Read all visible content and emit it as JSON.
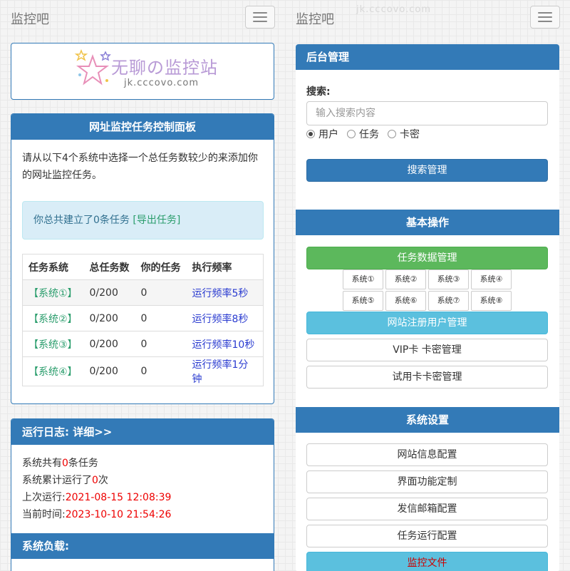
{
  "left": {
    "brand": "监控吧",
    "logo": {
      "title": "无聊の监控站",
      "subtitle": "jk.cccovo.com"
    },
    "task_panel": {
      "title": "网址监控任务控制面板",
      "intro": "请从以下4个系统中选择一个总任务数较少的来添加你的网址监控任务。",
      "alert_text": "你总共建立了0条任务 ",
      "alert_link": "[导出任务]",
      "columns": [
        "任务系统",
        "总任务数",
        "你的任务",
        "执行频率"
      ],
      "rows": [
        {
          "system": "【系统①】",
          "total": "0/200",
          "mine": "0",
          "freq": "运行频率5秒"
        },
        {
          "system": "【系统②】",
          "total": "0/200",
          "mine": "0",
          "freq": "运行频率8秒"
        },
        {
          "system": "【系统③】",
          "total": "0/200",
          "mine": "0",
          "freq": "运行频率10秒"
        },
        {
          "system": "【系统④】",
          "total": "0/200",
          "mine": "0",
          "freq": "运行频率1分钟"
        }
      ]
    },
    "log_panel": {
      "title": "运行日志:  详细>>",
      "line1_a": "系统共有",
      "line1_num": "0",
      "line1_b": "条任务",
      "line2_a": "系统累计运行了",
      "line2_num": "0",
      "line2_b": "次",
      "line3_a": "上次运行:",
      "line3_val": "2021-08-15 12:08:39",
      "line4_a": "当前时间:",
      "line4_val": "2023-10-10 21:54:26",
      "load_title": "系统负载:"
    }
  },
  "right": {
    "brand": "监控吧",
    "watermark": "jk.cccovo.com",
    "admin": {
      "title": "后台管理",
      "search_label": "搜索:",
      "search_placeholder": "输入搜索内容",
      "radios": [
        {
          "label": "用户",
          "checked": true
        },
        {
          "label": "任务",
          "checked": false
        },
        {
          "label": "卡密",
          "checked": false
        }
      ],
      "search_button": "搜索管理"
    },
    "basic": {
      "title": "基本操作",
      "task_data": "任务数据管理",
      "systems": [
        "系统①",
        "系统②",
        "系统③",
        "系统④",
        "系统⑤",
        "系统⑥",
        "系统⑦",
        "系统⑧"
      ],
      "user_mgmt": "网站注册用户管理",
      "vip": "VIP卡 卡密管理",
      "trial": "试用卡卡密管理"
    },
    "settings": {
      "title": "系统设置",
      "items": [
        "网站信息配置",
        "界面功能定制",
        "发信邮箱配置",
        "任务运行配置",
        "监控文件"
      ]
    }
  },
  "colors": {
    "primary": "#337ab7",
    "success": "#5cb85c",
    "info": "#5bc0de",
    "link_green": "#2a9d6c",
    "link_blue": "#2a3bd0",
    "red": "#e00000"
  }
}
